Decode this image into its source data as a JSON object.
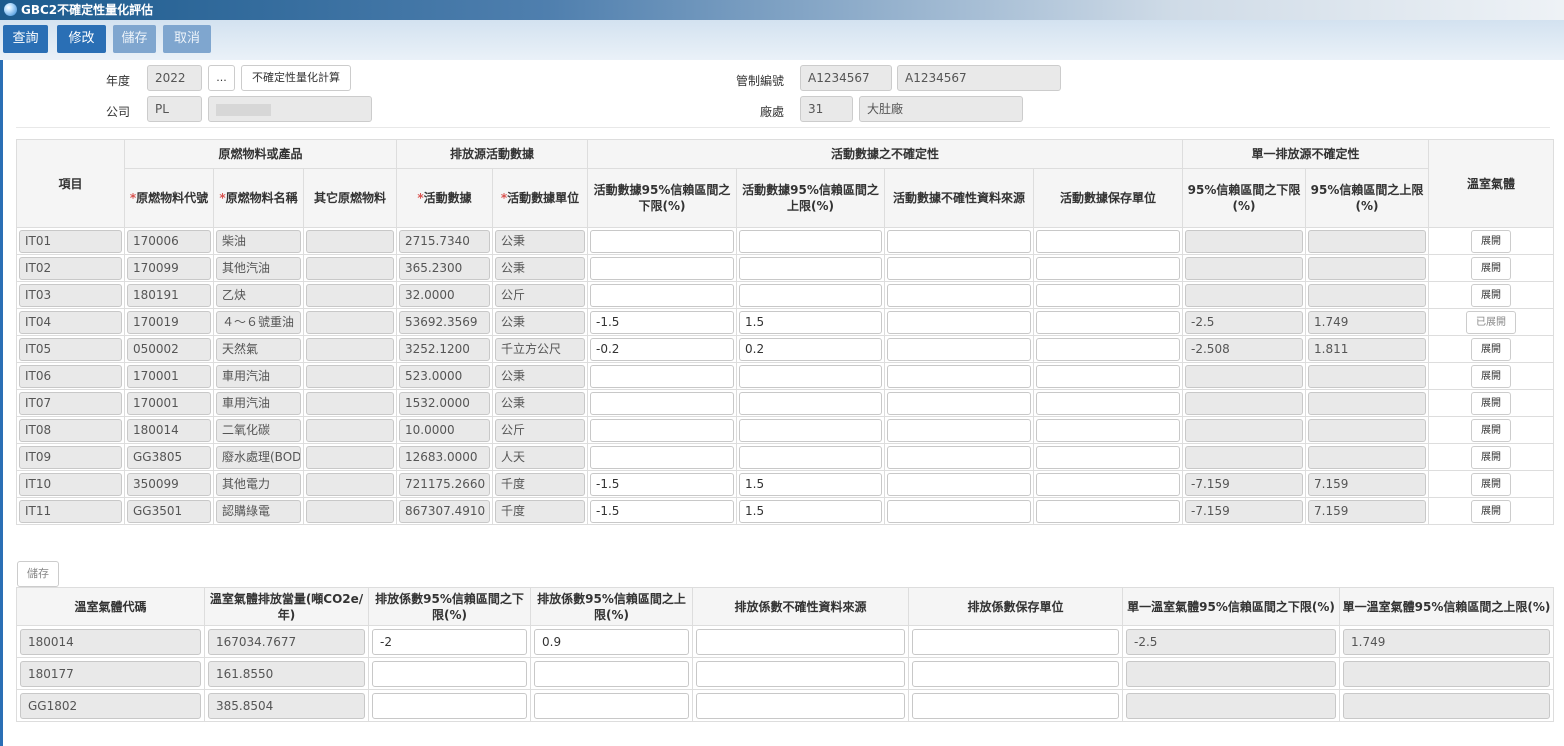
{
  "window": {
    "title": "GBC2不確定性量化評估"
  },
  "toolbar": {
    "query": "查詢",
    "edit": "修改",
    "save": "儲存",
    "cancel": "取消"
  },
  "form": {
    "year_label": "年度",
    "year_value": "2022",
    "lookup_btn": "...",
    "calc_btn": "不確定性量化計算",
    "company_label": "公司",
    "company_code": "PL",
    "company_name": "",
    "control_no_label": "管制編號",
    "control_no_1": "A1234567",
    "control_no_2": "A1234567",
    "plant_label": "廠處",
    "plant_code": "31",
    "plant_name": "大肚廠"
  },
  "table1": {
    "group_headers": {
      "item": "項目",
      "material": "原燃物料或產品",
      "activity": "排放源活動數據",
      "uncertainty": "活動數據之不確定性",
      "source_unc": "單一排放源不確定性",
      "ghg": "溫室氣體"
    },
    "sub_headers": {
      "material_code": "原燃物料代號",
      "material_name": "原燃物料名稱",
      "other_material": "其它原燃物料",
      "activity_data": "活動數據",
      "activity_unit": "活動數據單位",
      "lower_pct": "活動數據95%信賴區間之下限(%)",
      "upper_pct": "活動數據95%信賴區間之上限(%)",
      "data_source": "活動數據不確性資料來源",
      "keeper": "活動數據保存單位",
      "src_lower": "95%信賴區間之下限(%)",
      "src_upper": "95%信賴區間之上限(%)"
    },
    "rows": [
      {
        "item": "IT01",
        "code": "170006",
        "name": "柴油",
        "other": "",
        "activity": "2715.7340",
        "unit": "公秉",
        "lower": "",
        "upper": "",
        "source": "",
        "keeper": "",
        "src_lower": "",
        "src_upper": "",
        "btn": "展開"
      },
      {
        "item": "IT02",
        "code": "170099",
        "name": "其他汽油",
        "other": "",
        "activity": "365.2300",
        "unit": "公秉",
        "lower": "",
        "upper": "",
        "source": "",
        "keeper": "",
        "src_lower": "",
        "src_upper": "",
        "btn": "展開"
      },
      {
        "item": "IT03",
        "code": "180191",
        "name": "乙炔",
        "other": "",
        "activity": "32.0000",
        "unit": "公斤",
        "lower": "",
        "upper": "",
        "source": "",
        "keeper": "",
        "src_lower": "",
        "src_upper": "",
        "btn": "展開"
      },
      {
        "item": "IT04",
        "code": "170019",
        "name": "４～６號重油",
        "other": "",
        "activity": "53692.3569",
        "unit": "公秉",
        "lower": "-1.5",
        "upper": "1.5",
        "source": "",
        "keeper": "",
        "src_lower": "-2.5",
        "src_upper": "1.749",
        "btn": "已展開"
      },
      {
        "item": "IT05",
        "code": "050002",
        "name": "天然氣",
        "other": "",
        "activity": "3252.1200",
        "unit": "千立方公尺",
        "lower": "-0.2",
        "upper": "0.2",
        "source": "",
        "keeper": "",
        "src_lower": "-2.508",
        "src_upper": "1.811",
        "btn": "展開"
      },
      {
        "item": "IT06",
        "code": "170001",
        "name": "車用汽油",
        "other": "",
        "activity": "523.0000",
        "unit": "公秉",
        "lower": "",
        "upper": "",
        "source": "",
        "keeper": "",
        "src_lower": "",
        "src_upper": "",
        "btn": "展開"
      },
      {
        "item": "IT07",
        "code": "170001",
        "name": "車用汽油",
        "other": "",
        "activity": "1532.0000",
        "unit": "公秉",
        "lower": "",
        "upper": "",
        "source": "",
        "keeper": "",
        "src_lower": "",
        "src_upper": "",
        "btn": "展開"
      },
      {
        "item": "IT08",
        "code": "180014",
        "name": "二氧化碳",
        "other": "",
        "activity": "10.0000",
        "unit": "公斤",
        "lower": "",
        "upper": "",
        "source": "",
        "keeper": "",
        "src_lower": "",
        "src_upper": "",
        "btn": "展開"
      },
      {
        "item": "IT09",
        "code": "GG3805",
        "name": "廢水處理(BOD",
        "other": "",
        "activity": "12683.0000",
        "unit": "人天",
        "lower": "",
        "upper": "",
        "source": "",
        "keeper": "",
        "src_lower": "",
        "src_upper": "",
        "btn": "展開"
      },
      {
        "item": "IT10",
        "code": "350099",
        "name": "其他電力",
        "other": "",
        "activity": "721175.2660",
        "unit": "千度",
        "lower": "-1.5",
        "upper": "1.5",
        "source": "",
        "keeper": "",
        "src_lower": "-7.159",
        "src_upper": "7.159",
        "btn": "展開"
      },
      {
        "item": "IT11",
        "code": "GG3501",
        "name": "認購綠電",
        "other": "",
        "activity": "867307.4910",
        "unit": "千度",
        "lower": "-1.5",
        "upper": "1.5",
        "source": "",
        "keeper": "",
        "src_lower": "-7.159",
        "src_upper": "7.159",
        "btn": "展開"
      }
    ]
  },
  "section2": {
    "save_btn": "儲存"
  },
  "table2": {
    "headers": {
      "ghg_code": "溫室氣體代碼",
      "emission": "溫室氣體排放當量(噸CO2e/年)",
      "factor_lower": "排放係數95%信賴區間之下限(%)",
      "factor_upper": "排放係數95%信賴區間之上限(%)",
      "factor_source": "排放係數不確性資料來源",
      "factor_keeper": "排放係數保存單位",
      "ghg_lower": "單一溫室氣體95%信賴區間之下限(%)",
      "ghg_upper": "單一溫室氣體95%信賴區間之上限(%)"
    },
    "rows": [
      {
        "code": "180014",
        "emission": "167034.7677",
        "lower": "-2",
        "upper": "0.9",
        "source": "",
        "keeper": "",
        "ghg_lower": "-2.5",
        "ghg_upper": "1.749"
      },
      {
        "code": "180177",
        "emission": "161.8550",
        "lower": "",
        "upper": "",
        "source": "",
        "keeper": "",
        "ghg_lower": "",
        "ghg_upper": ""
      },
      {
        "code": "GG1802",
        "emission": "385.8504",
        "lower": "",
        "upper": "",
        "source": "",
        "keeper": "",
        "ghg_lower": "",
        "ghg_upper": ""
      }
    ]
  }
}
